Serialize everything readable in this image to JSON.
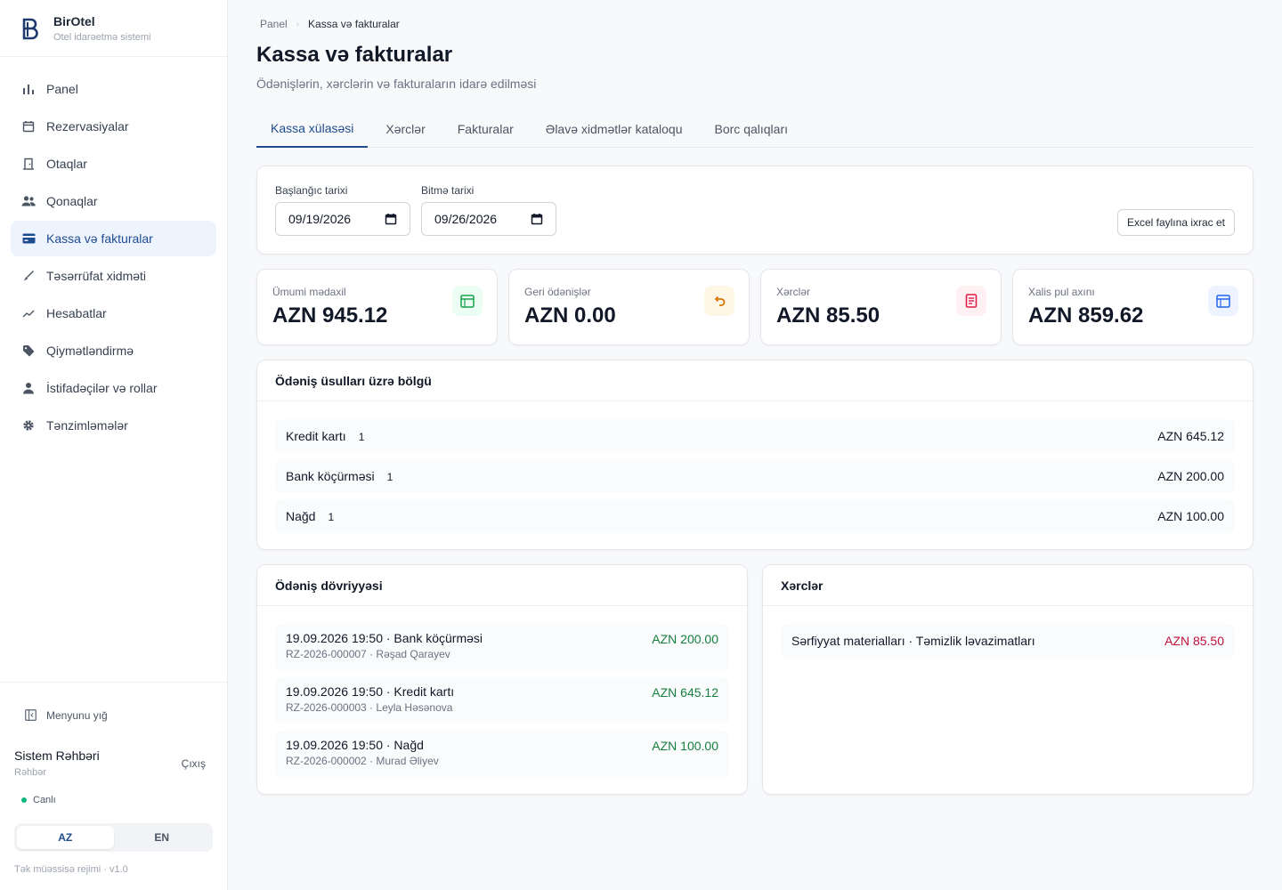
{
  "brand": {
    "name": "BirOtel",
    "subtitle": "Otel idarəetmə sistemi"
  },
  "sidebar": {
    "items": [
      {
        "label": "Panel",
        "icon": "bar-chart-icon"
      },
      {
        "label": "Rezervasiyalar",
        "icon": "calendar-icon"
      },
      {
        "label": "Otaqlar",
        "icon": "door-icon"
      },
      {
        "label": "Qonaqlar",
        "icon": "users-icon"
      },
      {
        "label": "Kassa və fakturalar",
        "icon": "credit-card-icon",
        "active": true
      },
      {
        "label": "Təsərrüfat xidməti",
        "icon": "broom-icon"
      },
      {
        "label": "Hesabatlar",
        "icon": "trend-icon"
      },
      {
        "label": "Qiymətləndirmə",
        "icon": "tag-icon"
      },
      {
        "label": "İstifadəçilər və rollar",
        "icon": "user-icon"
      },
      {
        "label": "Tənzimləmələr",
        "icon": "gear-icon"
      }
    ],
    "collapse_label": "Menyunu yığ",
    "user_name": "Sistem Rəhbəri",
    "user_role": "Rəhbər",
    "logout_label": "Çıxış",
    "status_label": "Canlı",
    "lang_az": "AZ",
    "lang_en": "EN",
    "version": "Tək müəssisə rejimi · v1.0"
  },
  "breadcrumb": {
    "home": "Panel",
    "current": "Kassa və fakturalar"
  },
  "page": {
    "title": "Kassa və fakturalar",
    "subtitle": "Ödənişlərin, xərclərin və fakturaların idarə edilməsi"
  },
  "tabs": [
    "Kassa xülasəsi",
    "Xərclər",
    "Fakturalar",
    "Əlavə xidmətlər kataloqu",
    "Borc qalıqları"
  ],
  "filters": {
    "start_label": "Başlanğıc tarixi",
    "start_value": "09/19/2026",
    "end_label": "Bitmə tarixi",
    "end_value": "09/26/2026",
    "export_label": "Excel faylına ixrac et"
  },
  "kpis": [
    {
      "label": "Ümumi mədaxil",
      "value": "AZN 945.12",
      "icon": "wallet-icon",
      "color": "#16a34a",
      "bg": "#ecfdf3"
    },
    {
      "label": "Geri ödənişlər",
      "value": "AZN 0.00",
      "icon": "undo-icon",
      "color": "#d97706",
      "bg": "#fff7e6"
    },
    {
      "label": "Xərclər",
      "value": "AZN 85.50",
      "icon": "receipt-icon",
      "color": "#e11d48",
      "bg": "#fff1f3"
    },
    {
      "label": "Xalis pul axını",
      "value": "AZN 859.62",
      "icon": "wallet-icon",
      "color": "#2563eb",
      "bg": "#eef4ff"
    }
  ],
  "breakdown": {
    "title": "Ödəniş üsulları üzrə bölgü",
    "rows": [
      {
        "method": "Kredit kartı",
        "count": "1",
        "amount": "AZN 645.12"
      },
      {
        "method": "Bank köçürməsi",
        "count": "1",
        "amount": "AZN 200.00"
      },
      {
        "method": "Nağd",
        "count": "1",
        "amount": "AZN 100.00"
      }
    ]
  },
  "turnover": {
    "title": "Ödəniş dövriyyəsi",
    "rows": [
      {
        "line1": "19.09.2026 19:50 · Bank köçürməsi",
        "line2": "RZ-2026-000007 · Rəşad Qarayev",
        "amount": "AZN 200.00"
      },
      {
        "line1": "19.09.2026 19:50 · Kredit kartı",
        "line2": "RZ-2026-000003 · Leyla Həsənova",
        "amount": "AZN 645.12"
      },
      {
        "line1": "19.09.2026 19:50 · Nağd",
        "line2": "RZ-2026-000002 · Murad Əliyev",
        "amount": "AZN 100.00"
      }
    ]
  },
  "expenses": {
    "title": "Xərclər",
    "rows": [
      {
        "label": "Sərfiyyat materialları · Təmizlik ləvazimatları",
        "amount": "AZN 85.50"
      }
    ]
  }
}
